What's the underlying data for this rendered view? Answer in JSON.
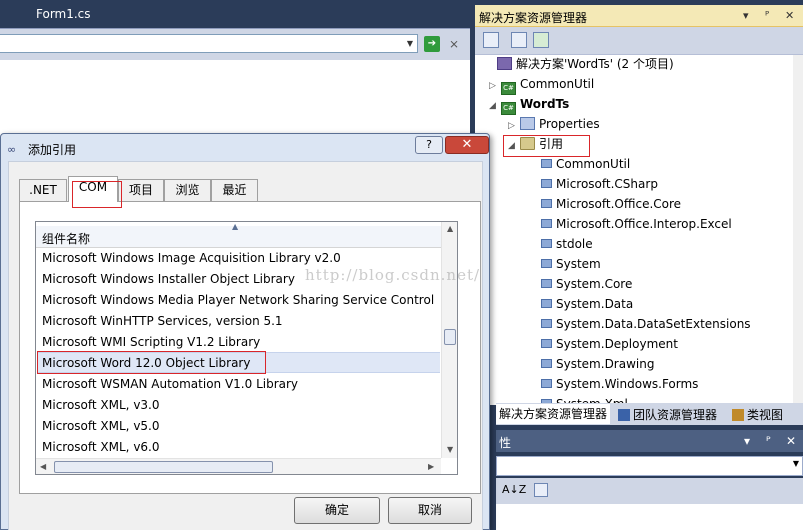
{
  "editor": {
    "tabs": [
      "",
      "Form1.cs"
    ],
    "nav_combo_value": ""
  },
  "solution_explorer": {
    "title": "解决方案资源管理器",
    "title_buttons": [
      "▾",
      "ᴾ",
      "✕"
    ],
    "tree": [
      {
        "label": "解决方案'WordTs' (2 个项目)",
        "icon": "solution-icon",
        "expander": "",
        "bold": false
      },
      {
        "label": "CommonUtil",
        "icon": "csharp-project-icon",
        "expander": "▷",
        "bold": false
      },
      {
        "label": "WordTs",
        "icon": "csharp-project-icon",
        "expander": "◢",
        "bold": true
      },
      {
        "label": "Properties",
        "icon": "properties-icon",
        "expander": "▷",
        "bold": false
      },
      {
        "label": "引用",
        "icon": "references-folder-icon",
        "expander": "◢",
        "bold": false
      },
      {
        "label": "CommonUtil",
        "icon": "reference-icon",
        "expander": "",
        "bold": false
      },
      {
        "label": "Microsoft.CSharp",
        "icon": "reference-icon",
        "expander": "",
        "bold": false
      },
      {
        "label": "Microsoft.Office.Core",
        "icon": "reference-icon",
        "expander": "",
        "bold": false
      },
      {
        "label": "Microsoft.Office.Interop.Excel",
        "icon": "reference-icon",
        "expander": "",
        "bold": false
      },
      {
        "label": "stdole",
        "icon": "reference-icon",
        "expander": "",
        "bold": false
      },
      {
        "label": "System",
        "icon": "reference-icon",
        "expander": "",
        "bold": false
      },
      {
        "label": "System.Core",
        "icon": "reference-icon",
        "expander": "",
        "bold": false
      },
      {
        "label": "System.Data",
        "icon": "reference-icon",
        "expander": "",
        "bold": false
      },
      {
        "label": "System.Data.DataSetExtensions",
        "icon": "reference-icon",
        "expander": "",
        "bold": false
      },
      {
        "label": "System.Deployment",
        "icon": "reference-icon",
        "expander": "",
        "bold": false
      },
      {
        "label": "System.Drawing",
        "icon": "reference-icon",
        "expander": "",
        "bold": false
      },
      {
        "label": "System.Windows.Forms",
        "icon": "reference-icon",
        "expander": "",
        "bold": false
      },
      {
        "label": "System.Xml",
        "icon": "reference-icon",
        "expander": "",
        "bold": false
      }
    ],
    "bottom_tabs": [
      "解决方案资源管理器",
      "团队资源管理器",
      "类视图"
    ]
  },
  "properties": {
    "title": "性",
    "title_buttons": [
      "▾",
      "ᴾ",
      "✕"
    ],
    "toolbar_sort": "A↓Z"
  },
  "dialog": {
    "title": "添加引用",
    "help_label": "?",
    "close_label": "✕",
    "tabs": [
      ".NET",
      "COM",
      "项目",
      "浏览",
      "最近"
    ],
    "active_tab": "COM",
    "column_header": "组件名称",
    "rows": [
      "Microsoft Windows Image Acquisition Library v2.0",
      "Microsoft Windows Installer Object Library",
      "Microsoft Windows Media Player Network Sharing Service Control",
      "Microsoft WinHTTP Services, version 5.1",
      "Microsoft WMI Scripting V1.2 Library",
      "Microsoft Word 12.0 Object Library",
      "Microsoft WSMAN Automation V1.0 Library",
      "Microsoft XML, v3.0",
      "Microsoft XML, v5.0",
      "Microsoft XML, v6.0"
    ],
    "selected_row": "Microsoft Word 12.0 Object Library",
    "ok_label": "确定",
    "cancel_label": "取消"
  },
  "watermark": "http://blog.csdn.net/",
  "colors": {
    "highlight_box": "#d9262a",
    "title_bar": "#f4e9b6",
    "ide_background": "#293955"
  }
}
